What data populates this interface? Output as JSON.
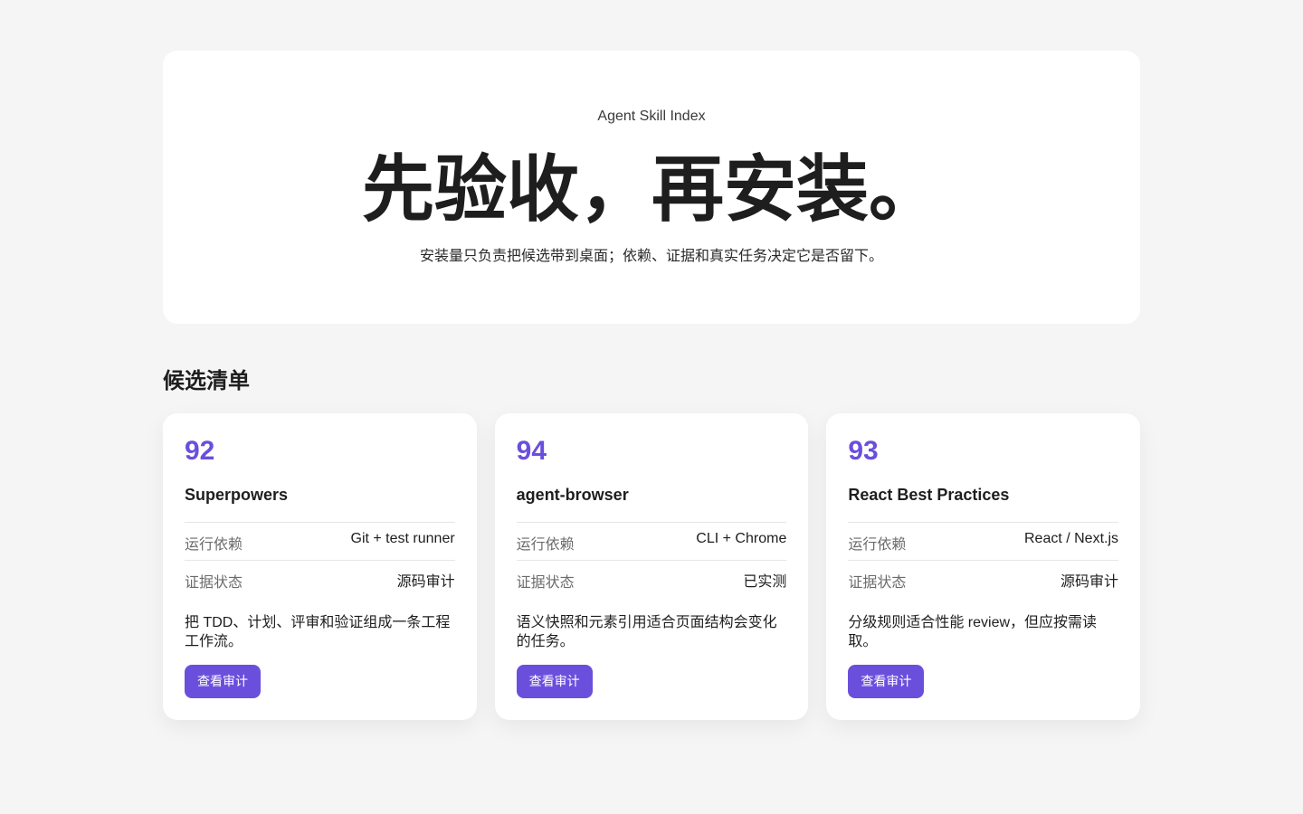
{
  "hero": {
    "eyebrow": "Agent Skill Index",
    "title": "先验收，再安装。",
    "subtitle": "安装量只负责把候选带到桌面；依赖、证据和真实任务决定它是否留下。"
  },
  "section": {
    "heading": "候选清单"
  },
  "cards": [
    {
      "score": "92",
      "name": "Superpowers",
      "rows": [
        {
          "label": "运行依赖",
          "value": "Git + test runner"
        },
        {
          "label": "证据状态",
          "value": "源码审计"
        }
      ],
      "description": "把 TDD、计划、评审和验证组成一条工程工作流。",
      "button_label": "查看审计"
    },
    {
      "score": "94",
      "name": "agent-browser",
      "rows": [
        {
          "label": "运行依赖",
          "value": "CLI + Chrome"
        },
        {
          "label": "证据状态",
          "value": "已实测"
        }
      ],
      "description": "语义快照和元素引用适合页面结构会变化的任务。",
      "button_label": "查看审计"
    },
    {
      "score": "93",
      "name": "React Best Practices",
      "rows": [
        {
          "label": "运行依赖",
          "value": "React / Next.js"
        },
        {
          "label": "证据状态",
          "value": "源码审计"
        }
      ],
      "description": "分级规则适合性能 review，但应按需读取。",
      "button_label": "查看审计"
    }
  ],
  "colors": {
    "accent": "#6a4fdd",
    "page_background": "#f5f5f5",
    "card_background": "#ffffff",
    "text_primary": "#1e1e1e",
    "text_muted": "#6b6b6b"
  }
}
